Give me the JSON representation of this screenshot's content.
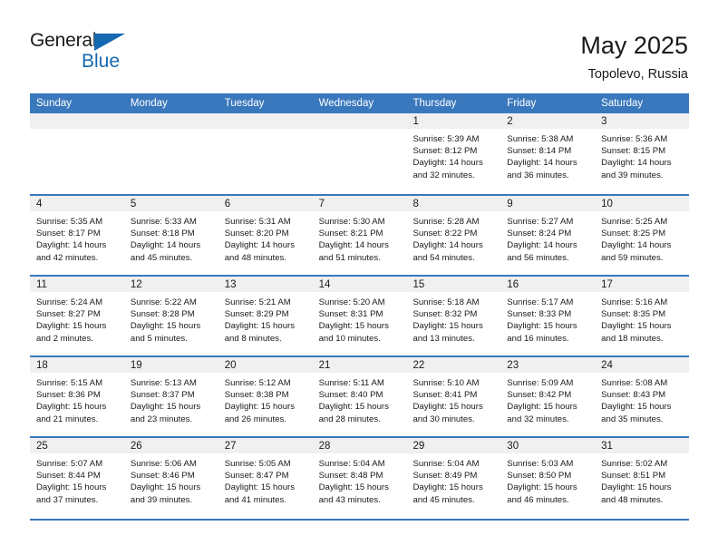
{
  "logo": {
    "top_text": "General",
    "bottom_text": "Blue",
    "triangle_name": "blue-triangle"
  },
  "header": {
    "title": "May 2025",
    "subtitle": "Topolevo, Russia"
  },
  "colors": {
    "header_blue": "#3a78bd",
    "logo_blue": "#1569b0",
    "day_band_gray": "#f0f0f0"
  },
  "weekdays": [
    "Sunday",
    "Monday",
    "Tuesday",
    "Wednesday",
    "Thursday",
    "Friday",
    "Saturday"
  ],
  "weeks": [
    [
      {
        "day": "",
        "lines": []
      },
      {
        "day": "",
        "lines": []
      },
      {
        "day": "",
        "lines": []
      },
      {
        "day": "",
        "lines": []
      },
      {
        "day": "1",
        "lines": [
          "Sunrise: 5:39 AM",
          "Sunset: 8:12 PM",
          "Daylight: 14 hours",
          "and 32 minutes."
        ]
      },
      {
        "day": "2",
        "lines": [
          "Sunrise: 5:38 AM",
          "Sunset: 8:14 PM",
          "Daylight: 14 hours",
          "and 36 minutes."
        ]
      },
      {
        "day": "3",
        "lines": [
          "Sunrise: 5:36 AM",
          "Sunset: 8:15 PM",
          "Daylight: 14 hours",
          "and 39 minutes."
        ]
      }
    ],
    [
      {
        "day": "4",
        "lines": [
          "Sunrise: 5:35 AM",
          "Sunset: 8:17 PM",
          "Daylight: 14 hours",
          "and 42 minutes."
        ]
      },
      {
        "day": "5",
        "lines": [
          "Sunrise: 5:33 AM",
          "Sunset: 8:18 PM",
          "Daylight: 14 hours",
          "and 45 minutes."
        ]
      },
      {
        "day": "6",
        "lines": [
          "Sunrise: 5:31 AM",
          "Sunset: 8:20 PM",
          "Daylight: 14 hours",
          "and 48 minutes."
        ]
      },
      {
        "day": "7",
        "lines": [
          "Sunrise: 5:30 AM",
          "Sunset: 8:21 PM",
          "Daylight: 14 hours",
          "and 51 minutes."
        ]
      },
      {
        "day": "8",
        "lines": [
          "Sunrise: 5:28 AM",
          "Sunset: 8:22 PM",
          "Daylight: 14 hours",
          "and 54 minutes."
        ]
      },
      {
        "day": "9",
        "lines": [
          "Sunrise: 5:27 AM",
          "Sunset: 8:24 PM",
          "Daylight: 14 hours",
          "and 56 minutes."
        ]
      },
      {
        "day": "10",
        "lines": [
          "Sunrise: 5:25 AM",
          "Sunset: 8:25 PM",
          "Daylight: 14 hours",
          "and 59 minutes."
        ]
      }
    ],
    [
      {
        "day": "11",
        "lines": [
          "Sunrise: 5:24 AM",
          "Sunset: 8:27 PM",
          "Daylight: 15 hours",
          "and 2 minutes."
        ]
      },
      {
        "day": "12",
        "lines": [
          "Sunrise: 5:22 AM",
          "Sunset: 8:28 PM",
          "Daylight: 15 hours",
          "and 5 minutes."
        ]
      },
      {
        "day": "13",
        "lines": [
          "Sunrise: 5:21 AM",
          "Sunset: 8:29 PM",
          "Daylight: 15 hours",
          "and 8 minutes."
        ]
      },
      {
        "day": "14",
        "lines": [
          "Sunrise: 5:20 AM",
          "Sunset: 8:31 PM",
          "Daylight: 15 hours",
          "and 10 minutes."
        ]
      },
      {
        "day": "15",
        "lines": [
          "Sunrise: 5:18 AM",
          "Sunset: 8:32 PM",
          "Daylight: 15 hours",
          "and 13 minutes."
        ]
      },
      {
        "day": "16",
        "lines": [
          "Sunrise: 5:17 AM",
          "Sunset: 8:33 PM",
          "Daylight: 15 hours",
          "and 16 minutes."
        ]
      },
      {
        "day": "17",
        "lines": [
          "Sunrise: 5:16 AM",
          "Sunset: 8:35 PM",
          "Daylight: 15 hours",
          "and 18 minutes."
        ]
      }
    ],
    [
      {
        "day": "18",
        "lines": [
          "Sunrise: 5:15 AM",
          "Sunset: 8:36 PM",
          "Daylight: 15 hours",
          "and 21 minutes."
        ]
      },
      {
        "day": "19",
        "lines": [
          "Sunrise: 5:13 AM",
          "Sunset: 8:37 PM",
          "Daylight: 15 hours",
          "and 23 minutes."
        ]
      },
      {
        "day": "20",
        "lines": [
          "Sunrise: 5:12 AM",
          "Sunset: 8:38 PM",
          "Daylight: 15 hours",
          "and 26 minutes."
        ]
      },
      {
        "day": "21",
        "lines": [
          "Sunrise: 5:11 AM",
          "Sunset: 8:40 PM",
          "Daylight: 15 hours",
          "and 28 minutes."
        ]
      },
      {
        "day": "22",
        "lines": [
          "Sunrise: 5:10 AM",
          "Sunset: 8:41 PM",
          "Daylight: 15 hours",
          "and 30 minutes."
        ]
      },
      {
        "day": "23",
        "lines": [
          "Sunrise: 5:09 AM",
          "Sunset: 8:42 PM",
          "Daylight: 15 hours",
          "and 32 minutes."
        ]
      },
      {
        "day": "24",
        "lines": [
          "Sunrise: 5:08 AM",
          "Sunset: 8:43 PM",
          "Daylight: 15 hours",
          "and 35 minutes."
        ]
      }
    ],
    [
      {
        "day": "25",
        "lines": [
          "Sunrise: 5:07 AM",
          "Sunset: 8:44 PM",
          "Daylight: 15 hours",
          "and 37 minutes."
        ]
      },
      {
        "day": "26",
        "lines": [
          "Sunrise: 5:06 AM",
          "Sunset: 8:46 PM",
          "Daylight: 15 hours",
          "and 39 minutes."
        ]
      },
      {
        "day": "27",
        "lines": [
          "Sunrise: 5:05 AM",
          "Sunset: 8:47 PM",
          "Daylight: 15 hours",
          "and 41 minutes."
        ]
      },
      {
        "day": "28",
        "lines": [
          "Sunrise: 5:04 AM",
          "Sunset: 8:48 PM",
          "Daylight: 15 hours",
          "and 43 minutes."
        ]
      },
      {
        "day": "29",
        "lines": [
          "Sunrise: 5:04 AM",
          "Sunset: 8:49 PM",
          "Daylight: 15 hours",
          "and 45 minutes."
        ]
      },
      {
        "day": "30",
        "lines": [
          "Sunrise: 5:03 AM",
          "Sunset: 8:50 PM",
          "Daylight: 15 hours",
          "and 46 minutes."
        ]
      },
      {
        "day": "31",
        "lines": [
          "Sunrise: 5:02 AM",
          "Sunset: 8:51 PM",
          "Daylight: 15 hours",
          "and 48 minutes."
        ]
      }
    ]
  ]
}
